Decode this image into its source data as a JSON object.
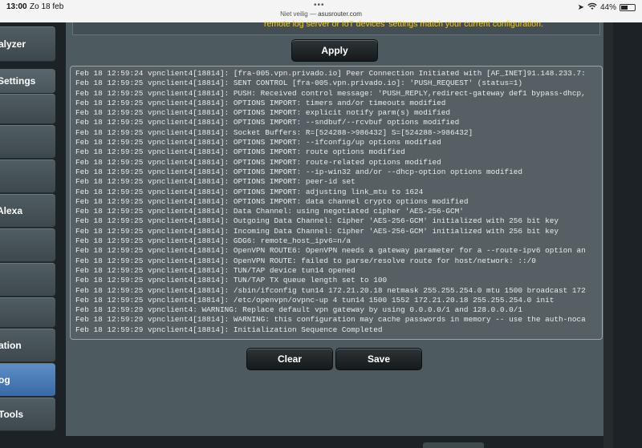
{
  "status_bar": {
    "time": "13:00",
    "date": "Zo 18 feb",
    "url_prefix": "Niet veilig",
    "url_sep": " — ",
    "url_host": "asusrouter.com",
    "battery": "44%",
    "battery_level": 0.44
  },
  "sidebar": {
    "items": [
      {
        "label": "alyzer",
        "active": false
      },
      {
        "label": "",
        "active": false
      },
      {
        "label": "",
        "active": false
      },
      {
        "label": "Alexa",
        "active": false
      },
      {
        "label": "",
        "active": false
      },
      {
        "label": "",
        "active": false
      },
      {
        "label": "ation",
        "active": false
      },
      {
        "label": "og",
        "active": true
      },
      {
        "label": "Tools",
        "active": false
      }
    ],
    "section_header": "Settings"
  },
  "panel": {
    "top_message": "remote log server or IoT devices' settings match your current configuration.",
    "apply_label": "Apply",
    "clear_label": "Clear",
    "save_label": "Save"
  },
  "log": {
    "lines": [
      "Feb 18 12:59:24 vpnclient4[18814]: [fra-005.vpn.privado.io] Peer Connection Initiated with [AF_INET]91.148.233.7:",
      "Feb 18 12:59:25 vpnclient4[18814]: SENT CONTROL [fra-005.vpn.privado.io]: 'PUSH_REQUEST' (status=1)",
      "Feb 18 12:59:25 vpnclient4[18814]: PUSH: Received control message: 'PUSH_REPLY,redirect-gateway def1 bypass-dhcp,",
      "Feb 18 12:59:25 vpnclient4[18814]: OPTIONS IMPORT: timers and/or timeouts modified",
      "Feb 18 12:59:25 vpnclient4[18814]: OPTIONS IMPORT: explicit notify parm(s) modified",
      "Feb 18 12:59:25 vpnclient4[18814]: OPTIONS IMPORT: --sndbuf/--rcvbuf options modified",
      "Feb 18 12:59:25 vpnclient4[18814]: Socket Buffers: R=[524288->986432] S=[524288->986432]",
      "Feb 18 12:59:25 vpnclient4[18814]: OPTIONS IMPORT: --ifconfig/up options modified",
      "Feb 18 12:59:25 vpnclient4[18814]: OPTIONS IMPORT: route options modified",
      "Feb 18 12:59:25 vpnclient4[18814]: OPTIONS IMPORT: route-related options modified",
      "Feb 18 12:59:25 vpnclient4[18814]: OPTIONS IMPORT: --ip-win32 and/or --dhcp-option options modified",
      "Feb 18 12:59:25 vpnclient4[18814]: OPTIONS IMPORT: peer-id set",
      "Feb 18 12:59:25 vpnclient4[18814]: OPTIONS IMPORT: adjusting link_mtu to 1624",
      "Feb 18 12:59:25 vpnclient4[18814]: OPTIONS IMPORT: data channel crypto options modified",
      "Feb 18 12:59:25 vpnclient4[18814]: Data Channel: using negotiated cipher 'AES-256-GCM'",
      "Feb 18 12:59:25 vpnclient4[18814]: Outgoing Data Channel: Cipher 'AES-256-GCM' initialized with 256 bit key",
      "Feb 18 12:59:25 vpnclient4[18814]: Incoming Data Channel: Cipher 'AES-256-GCM' initialized with 256 bit key",
      "Feb 18 12:59:25 vpnclient4[18814]: GDG6: remote_host_ipv6=n/a",
      "Feb 18 12:59:25 vpnclient4[18814]: OpenVPN ROUTE6: OpenVPN needs a gateway parameter for a --route-ipv6 option an",
      "Feb 18 12:59:25 vpnclient4[18814]: OpenVPN ROUTE: failed to parse/resolve route for host/network: ::/0",
      "Feb 18 12:59:25 vpnclient4[18814]: TUN/TAP device tun14 opened",
      "Feb 18 12:59:25 vpnclient4[18814]: TUN/TAP TX queue length set to 100",
      "Feb 18 12:59:25 vpnclient4[18814]: /sbin/ifconfig tun14 172.21.20.18 netmask 255.255.254.0 mtu 1500 broadcast 172",
      "Feb 18 12:59:25 vpnclient4[18814]: /etc/openvpn/ovpnc-up 4 tun14 1500 1552 172.21.20.18 255.255.254.0 init",
      "Feb 18 12:59:29 vpnclient4: WARNING: Replace default vpn gateway by using 0.0.0.0/1 and 128.0.0.0/1",
      "Feb 18 12:59:29 vpnclient4[18814]: WARNING: this configuration may cache passwords in memory -- use the auth-noca",
      "Feb 18 12:59:29 vpnclient4[18814]: Initialization Sequence Completed"
    ]
  }
}
